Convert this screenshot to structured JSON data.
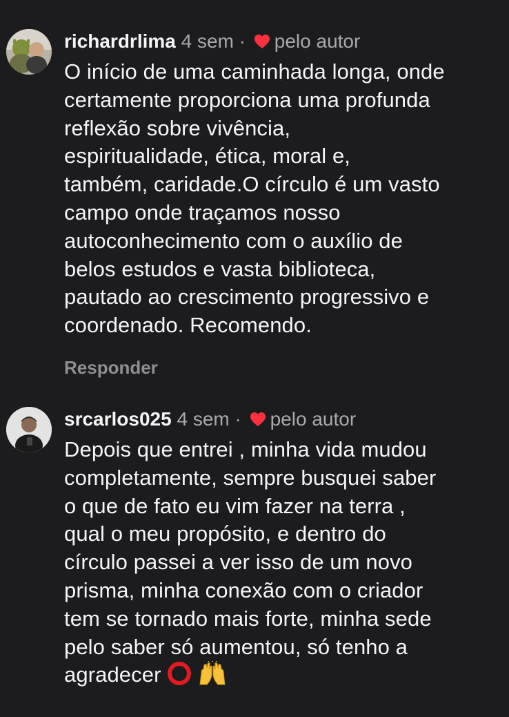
{
  "comments": [
    {
      "username": "richardrlima",
      "time": "4 sem",
      "dot": "·",
      "liked_label": "pelo autor",
      "text": "O início de uma caminhada longa, onde\ncertamente proporciona uma profunda\nreflexão sobre vivência,\nespiritualidade, ética, moral e,\ntambém, caridade.O círculo é um vasto\ncampo onde traçamos nosso\nautoconhecimento com o auxílio de\nbelos estudos e vasta biblioteca,\npautado ao crescimento progressivo e\ncoordenado. Recomendo.",
      "reply_label": "Responder"
    },
    {
      "username": "srcarlos025",
      "time": "4 sem",
      "dot": "·",
      "liked_label": "pelo autor",
      "text": "Depois que entrei , minha vida mudou\ncompletamente, sempre busquei saber\no que de fato eu vim fazer na terra ,\nqual o meu propósito, e dentro do\ncírculo passei a ver isso de um novo\nprisma, minha conexão com o criador\ntem se tornado mais  forte, minha sede\npelo saber só aumentou, só tenho a\nagradecer",
      "emojis": [
        "red-circle-ring-icon",
        "raising-hands-icon"
      ]
    }
  ],
  "colors": {
    "background": "#1c1c1e",
    "text_primary": "#f5f5f5",
    "text_secondary": "#a8a8ad",
    "heart": "#ff3040"
  }
}
